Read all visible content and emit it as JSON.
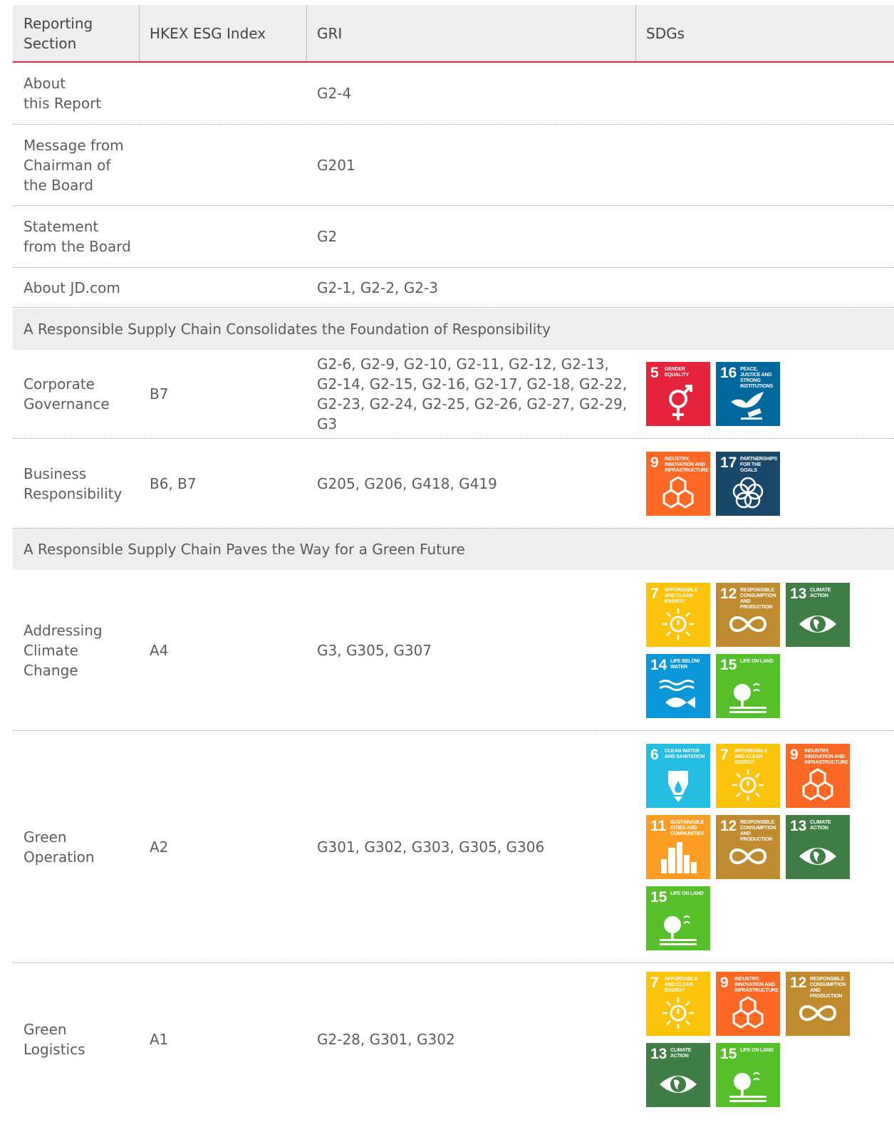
{
  "header": {
    "col1": "Reporting\nSection",
    "col2": "HKEX ESG Index",
    "col3": "GRI",
    "col4": "SDGs"
  },
  "rows": [
    {
      "section": "About\nthis Report",
      "hkex": "",
      "gri": "G2-4"
    },
    {
      "section": "Message from\nChairman of\nthe Board",
      "hkex": "",
      "gri": "G201"
    },
    {
      "section": "Statement\nfrom the Board",
      "hkex": "",
      "gri": "G2"
    },
    {
      "section": "About JD.com",
      "hkex": "",
      "gri": "G2-1, G2-2, G2-3"
    },
    {
      "band": "A Responsible Supply Chain Consolidates the Foundation of Responsibility"
    },
    {
      "section": "Corporate\nGovernance",
      "hkex": "B7",
      "gri": "G2-6, G2-9, G2-10, G2-11, G2-12, G2-13, G2-14, G2-15, G2-16, G2-17, G2-18, G2-22, G2-23, G2-24, G2-25, G2-26, G2-27, G2-29, G3"
    },
    {
      "section": "Business\nResponsibility",
      "hkex": "B6, B7",
      "gri": "G205, G206, G418, G419"
    },
    {
      "band": "A Responsible Supply Chain Paves the Way for a Green Future"
    },
    {
      "section": "Addressing\nClimate\nChange",
      "hkex": "A4",
      "gri": "G3, G305, G307"
    },
    {
      "section": "Green\nOperation",
      "hkex": "A2",
      "gri": "G301, G302, G303, G305, G306"
    },
    {
      "section": "Green\nLogistics",
      "hkex": "A1",
      "gri": "G2-28, G301, G302"
    }
  ],
  "sdg_goals": {
    "5": {
      "num": "5",
      "label": "Gender Equality",
      "color": "#e5243b",
      "icon": "gender-equality-icon"
    },
    "6": {
      "num": "6",
      "label": "Clean Water and Sanitation",
      "color": "#26bde2",
      "icon": "water-drop-icon"
    },
    "7": {
      "num": "7",
      "label": "Affordable and Clean Energy",
      "color": "#fcc30b",
      "icon": "sun-power-icon"
    },
    "9": {
      "num": "9",
      "label": "Industry, Innovation and Infrastructure",
      "color": "#fd6925",
      "icon": "cubes-icon"
    },
    "11": {
      "num": "11",
      "label": "Sustainable Cities and Communities",
      "color": "#fd9d24",
      "icon": "city-icon"
    },
    "12": {
      "num": "12",
      "label": "Responsible Consumption and Production",
      "color": "#bf8b2e",
      "icon": "infinity-icon"
    },
    "13": {
      "num": "13",
      "label": "Climate Action",
      "color": "#3f7e44",
      "icon": "eye-globe-icon"
    },
    "14": {
      "num": "14",
      "label": "Life Below Water",
      "color": "#0a97d9",
      "icon": "fish-icon"
    },
    "15": {
      "num": "15",
      "label": "Life on Land",
      "color": "#56c02b",
      "icon": "tree-icon"
    },
    "16": {
      "num": "16",
      "label": "Peace, Justice and Strong Institutions",
      "color": "#00689d",
      "icon": "dove-gavel-icon"
    },
    "17": {
      "num": "17",
      "label": "Partnerships for the Goals",
      "color": "#19486a",
      "icon": "rings-icon"
    }
  },
  "row_sdgs": [
    [],
    [],
    [],
    [],
    null,
    [
      "5",
      "16"
    ],
    [
      "9",
      "17"
    ],
    null,
    [
      "7",
      "12",
      "13",
      "14",
      "15"
    ],
    [
      "6",
      "7",
      "9",
      "11",
      "12",
      "13",
      "15"
    ],
    [
      "7",
      "9",
      "12",
      "13",
      "15"
    ]
  ]
}
